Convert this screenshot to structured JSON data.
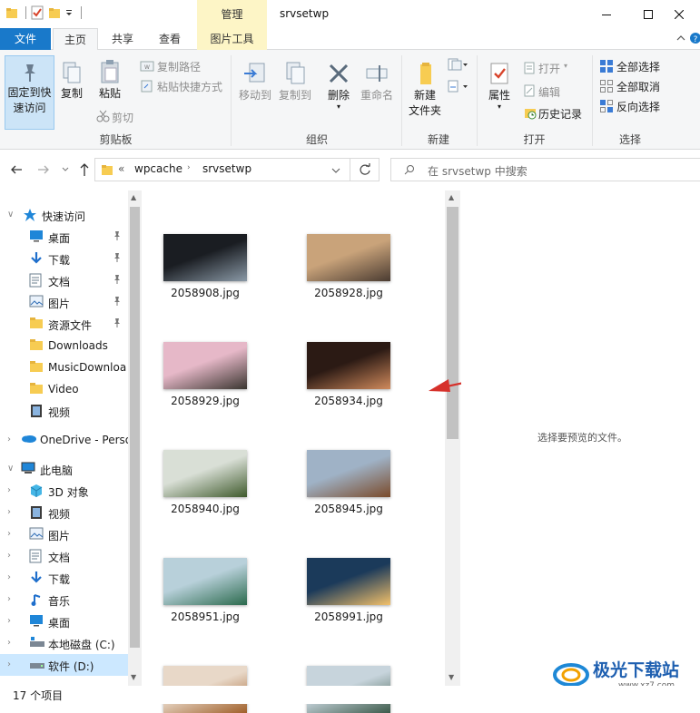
{
  "titlebar": {
    "context_tab": "管理",
    "window_title": "srvsetwp",
    "min_icon": "minimize-icon",
    "max_icon": "maximize-icon",
    "close_icon": "close-icon"
  },
  "tabs": {
    "file": "文件",
    "home": "主页",
    "share": "共享",
    "view": "查看",
    "picture_tools": "图片工具"
  },
  "ribbon": {
    "clipboard": {
      "pin": "固定到快速访问",
      "pin_l1": "固定到快",
      "pin_l2": "速访问",
      "copy": "复制",
      "paste": "粘贴",
      "copy_path": "复制路径",
      "paste_shortcut": "粘贴快捷方式",
      "cut": "剪切",
      "label": "剪贴板"
    },
    "organize": {
      "move_to": "移动到",
      "copy_to": "复制到",
      "delete": "删除",
      "rename": "重命名",
      "label": "组织"
    },
    "new": {
      "new_folder_l1": "新建",
      "new_folder_l2": "文件夹",
      "label": "新建"
    },
    "open": {
      "properties": "属性",
      "open": "打开",
      "edit": "编辑",
      "history": "历史记录",
      "label": "打开"
    },
    "select": {
      "select_all": "全部选择",
      "select_none": "全部取消",
      "invert": "反向选择",
      "label": "选择"
    }
  },
  "address": {
    "overflow": "«",
    "crumbs": [
      "wpcache",
      "srvsetwp"
    ],
    "search_placeholder": "在 srvsetwp 中搜索"
  },
  "nav": {
    "quick_access": "快速访问",
    "quick_items": [
      {
        "label": "桌面",
        "icon": "desktop-icon",
        "pinned": true
      },
      {
        "label": "下载",
        "icon": "download-icon",
        "pinned": true
      },
      {
        "label": "文档",
        "icon": "document-icon",
        "pinned": true
      },
      {
        "label": "图片",
        "icon": "picture-icon",
        "pinned": true
      },
      {
        "label": "资源文件",
        "icon": "folder-icon",
        "pinned": true
      },
      {
        "label": "Downloads",
        "icon": "folder-icon",
        "pinned": false
      },
      {
        "label": "MusicDownloa",
        "icon": "folder-icon",
        "pinned": false
      },
      {
        "label": "Video",
        "icon": "folder-icon",
        "pinned": false
      },
      {
        "label": "视频",
        "icon": "video-icon",
        "pinned": false
      }
    ],
    "onedrive": "OneDrive - Perso",
    "this_pc": "此电脑",
    "pc_items": [
      {
        "label": "3D 对象",
        "icon": "3d-objects-icon"
      },
      {
        "label": "视频",
        "icon": "video-icon"
      },
      {
        "label": "图片",
        "icon": "picture-icon"
      },
      {
        "label": "文档",
        "icon": "document-icon"
      },
      {
        "label": "下载",
        "icon": "download-icon"
      },
      {
        "label": "音乐",
        "icon": "music-icon"
      },
      {
        "label": "桌面",
        "icon": "desktop-icon"
      },
      {
        "label": "本地磁盘 (C:)",
        "icon": "drive-c-icon"
      },
      {
        "label": "软件 (D:)",
        "icon": "drive-d-icon"
      }
    ]
  },
  "files": [
    {
      "name": "2058908.jpg",
      "colors": [
        "#1a1d22",
        "#8a99a6"
      ]
    },
    {
      "name": "2058928.jpg",
      "colors": [
        "#c9a37a",
        "#4a3b31"
      ]
    },
    {
      "name": "2058929.jpg",
      "colors": [
        "#e6b8c8",
        "#3a3630"
      ]
    },
    {
      "name": "2058934.jpg",
      "colors": [
        "#2b1a14",
        "#d08a5c"
      ]
    },
    {
      "name": "2058940.jpg",
      "colors": [
        "#d9dfd6",
        "#3f5a2c"
      ]
    },
    {
      "name": "2058945.jpg",
      "colors": [
        "#9fb2c6",
        "#7a4a2a"
      ]
    },
    {
      "name": "2058951.jpg",
      "colors": [
        "#b8d0da",
        "#2b6a4d"
      ]
    },
    {
      "name": "2058991.jpg",
      "colors": [
        "#1b3a5a",
        "#f3c16a"
      ]
    },
    {
      "name": "",
      "colors": [
        "#e8d8c8",
        "#a0602a"
      ]
    },
    {
      "name": "",
      "colors": [
        "#c7d4dc",
        "#3c5a4a"
      ]
    }
  ],
  "preview": {
    "empty_text": "选择要预览的文件。"
  },
  "status": {
    "count": "17 个项目"
  },
  "watermark": {
    "text": "极光下载站",
    "url": "www.xz7.com"
  }
}
